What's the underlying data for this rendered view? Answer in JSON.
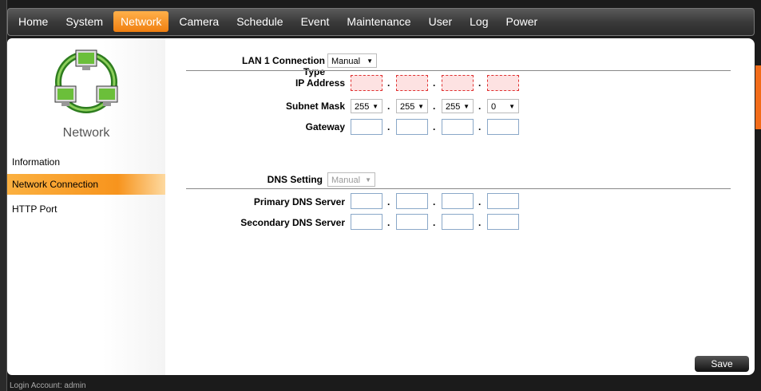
{
  "nav": [
    "Home",
    "System",
    "Network",
    "Camera",
    "Schedule",
    "Event",
    "Maintenance",
    "User",
    "Log",
    "Power"
  ],
  "nav_active": "Network",
  "sidebar": {
    "title": "Network",
    "items": [
      {
        "label": "Information"
      },
      {
        "label": "Network Connection"
      },
      {
        "label": "HTTP Port"
      }
    ],
    "active": "Network Connection"
  },
  "form": {
    "lan_type_label": "LAN 1 Connection Type",
    "lan_type_value": "Manual",
    "ip_label": "IP Address",
    "subnet_label": "Subnet Mask",
    "subnet_values": [
      "255",
      "255",
      "255",
      "0"
    ],
    "gateway_label": "Gateway",
    "dns_setting_label": "DNS Setting",
    "dns_setting_value": "Manual",
    "primary_dns_label": "Primary DNS Server",
    "secondary_dns_label": "Secondary DNS Server",
    "dot": ".",
    "arrow": "▼"
  },
  "save_label": "Save",
  "status": "Login Account: admin",
  "colors": {
    "accent": "#f7941d",
    "error_border": "#e03030"
  }
}
